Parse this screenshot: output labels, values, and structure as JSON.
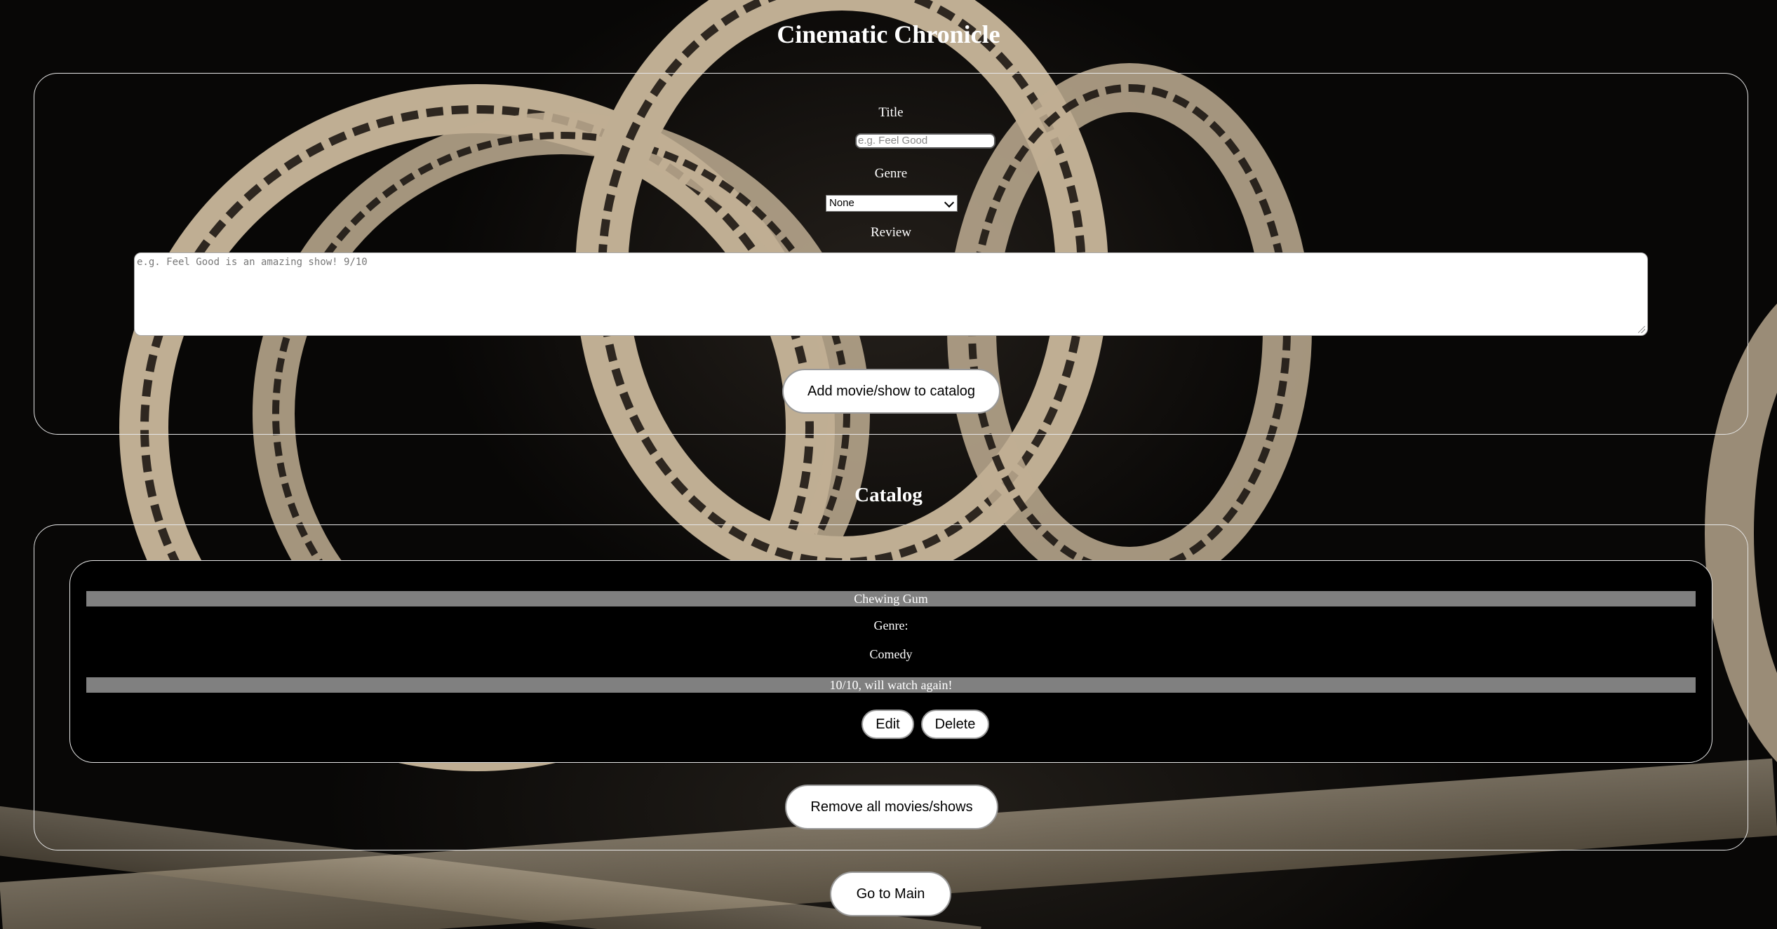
{
  "page": {
    "title": "Cinematic Chronicle"
  },
  "form": {
    "title_label": "Title",
    "title_placeholder": "e.g. Feel Good",
    "genre_label": "Genre",
    "genre_selected": "None",
    "review_label": "Review",
    "review_placeholder": "e.g. Feel Good is an amazing show! 9/10",
    "add_button": "Add movie/show to catalog"
  },
  "catalog": {
    "heading": "Catalog",
    "items": [
      {
        "title": "Chewing Gum",
        "genre_label": "Genre:",
        "genre": "Comedy",
        "review": "10/10, will watch again!",
        "edit_button": "Edit",
        "delete_button": "Delete"
      }
    ],
    "remove_all_button": "Remove all movies/shows"
  },
  "footer": {
    "main_button": "Go to Main"
  }
}
